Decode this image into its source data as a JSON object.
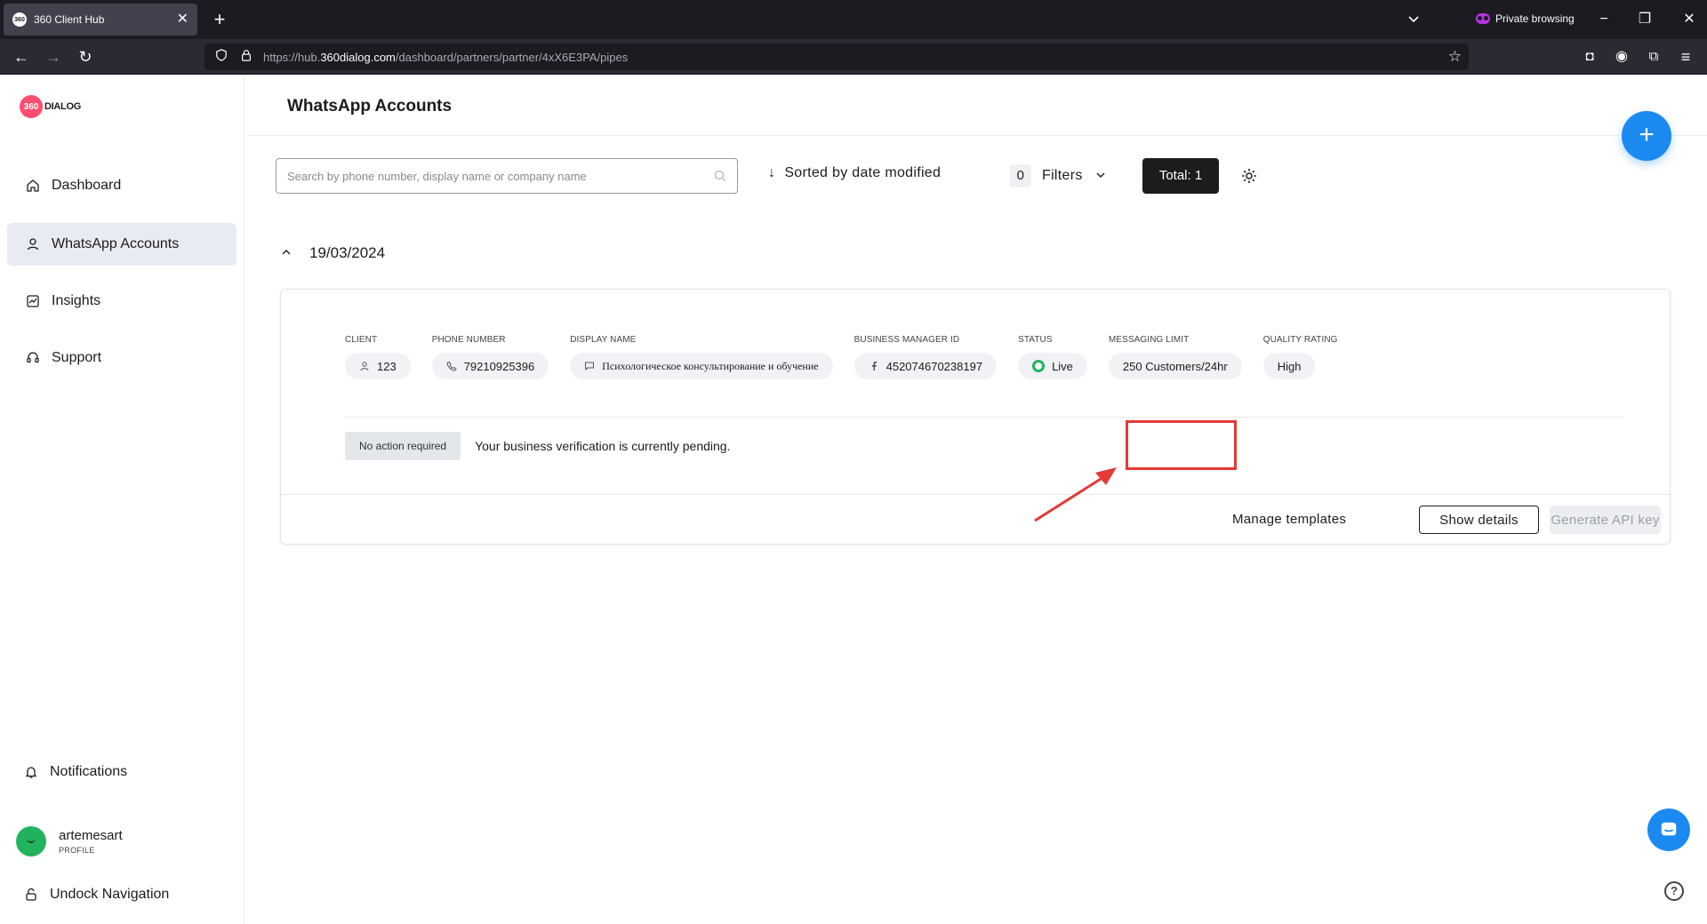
{
  "browser": {
    "tab_title": "360 Client Hub",
    "favicon_text": "360",
    "private_label": "Private browsing",
    "url_prefix": "https://hub.",
    "url_domain": "360dialog.com",
    "url_path": "/dashboard/partners/partner/4xX6E3PA/pipes"
  },
  "sidebar": {
    "logo_mark": "360",
    "logo_text": "DIALOG",
    "items": [
      {
        "label": "Dashboard",
        "icon": "home-icon"
      },
      {
        "label": "WhatsApp Accounts",
        "icon": "user-icon"
      },
      {
        "label": "Insights",
        "icon": "chart-icon"
      },
      {
        "label": "Support",
        "icon": "headset-icon"
      }
    ],
    "notifications_label": "Notifications",
    "profile_name": "artemesart",
    "profile_sub": "PROFILE",
    "undock_label": "Undock Navigation"
  },
  "main": {
    "title": "WhatsApp Accounts",
    "search_placeholder": "Search by phone number, display name or company name",
    "sort_label": "Sorted by date modified",
    "filter_count": "0",
    "filters_label": "Filters",
    "total_label": "Total: 1",
    "date_group": "19/03/2024"
  },
  "account": {
    "client_label": "CLIENT",
    "client_value": "123",
    "phone_label": "PHONE NUMBER",
    "phone_value": "79210925396",
    "display_label": "DISPLAY NAME",
    "display_value": "Психологическое консультирование и обучение",
    "bm_label": "BUSINESS MANAGER ID",
    "bm_value": "452074670238197",
    "status_label": "STATUS",
    "status_value": "Live",
    "limit_label": "MESSAGING LIMIT",
    "limit_value": "250 Customers/24hr",
    "quality_label": "QUALITY RATING",
    "quality_value": "High",
    "notice_tag": "No action required",
    "notice_text": "Your business verification is currently pending.",
    "manage_templates": "Manage templates",
    "show_details": "Show details",
    "generate_api_key": "Generate API key"
  },
  "colors": {
    "accent": "#1a8af0",
    "status_live": "#22b35e",
    "annotation": "#e53935"
  }
}
